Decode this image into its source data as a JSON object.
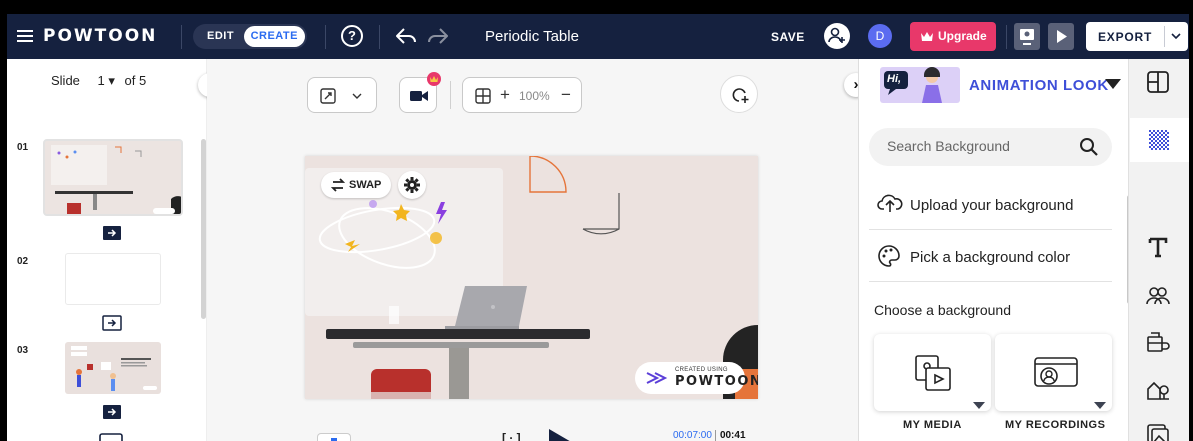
{
  "app": {
    "logo": "POWTOON",
    "doc_title": "Periodic Table"
  },
  "toolbar": {
    "edit_label": "EDIT",
    "create_label": "CREATE",
    "save_label": "SAVE",
    "avatar_initial": "D",
    "upgrade_label": "Upgrade",
    "export_label": "EXPORT"
  },
  "slides": {
    "label": "Slide",
    "current": "1",
    "of_text": "of 5",
    "items": [
      {
        "number": "01"
      },
      {
        "number": "02"
      },
      {
        "number": "03"
      }
    ]
  },
  "canvas": {
    "zoom": "100%",
    "swap_label": "SWAP",
    "badge_small": "CREATED USING",
    "badge_big": "POWTOON",
    "time_current": "00:07:00",
    "time_total": "00:41"
  },
  "right_panel": {
    "look_thumb_text": "Hi,",
    "look_title": "ANIMATION LOOK",
    "search_placeholder": "Search Background",
    "upload_label": "Upload your background",
    "color_label": "Pick a background color",
    "choose_label": "Choose a background",
    "my_media_label": "MY MEDIA",
    "my_recordings_label": "MY RECORDINGS"
  },
  "colors": {
    "topbar": "#15213f",
    "accent_blue": "#2b6bf0",
    "upgrade_pink": "#e8386a",
    "look_title": "#3e4fd8",
    "stage_bg": "#ece2df",
    "shape_orange": "#e5743a",
    "chair_red": "#b8302c"
  },
  "icons": {
    "menu": "hamburger-icon",
    "help": "question-icon",
    "undo": "undo-icon",
    "redo": "redo-icon",
    "add_collaborator": "add-user-icon",
    "upgrade": "crown-icon",
    "search": "search-icon",
    "upload": "cloud-upload-icon",
    "palette": "palette-icon"
  }
}
